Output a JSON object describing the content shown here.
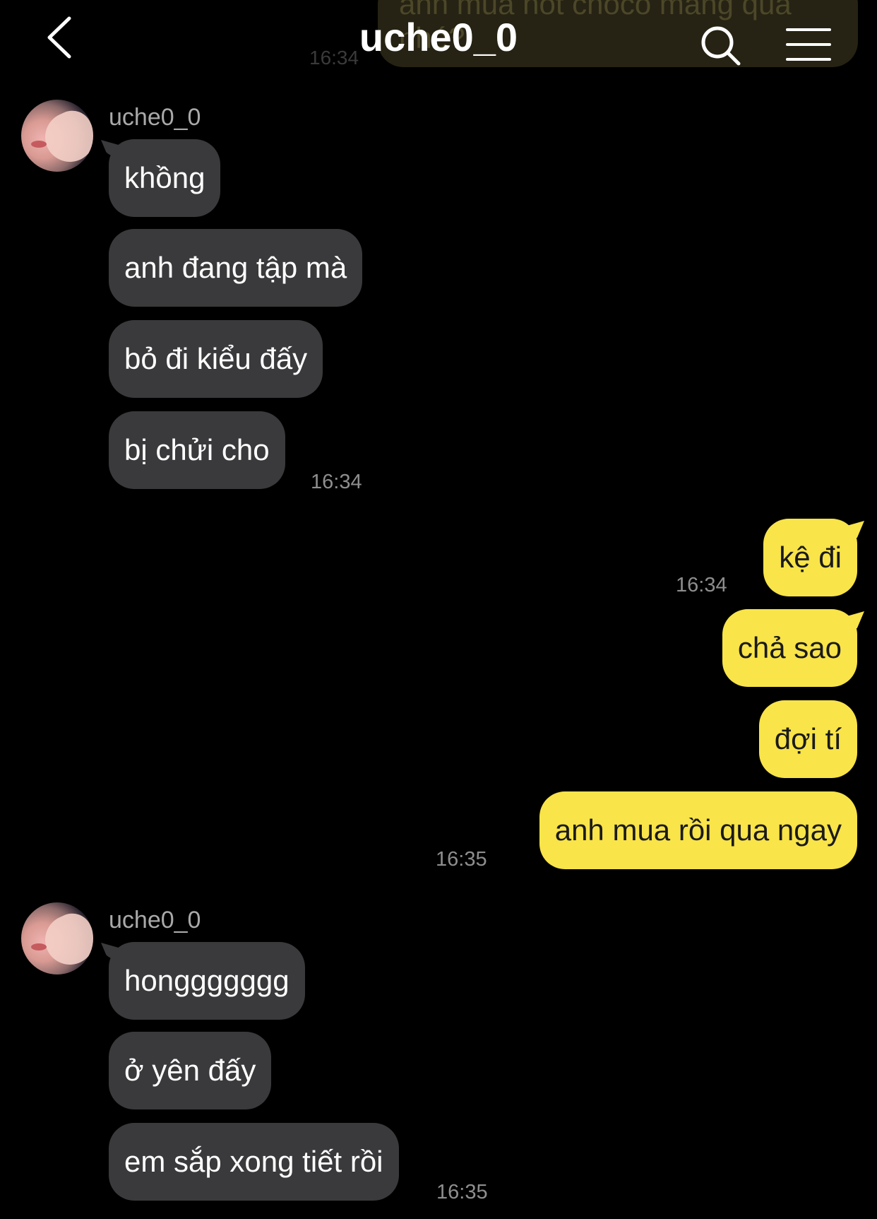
{
  "app": {
    "title": "uche0_0"
  },
  "icons": {
    "back": "chevron-left-icon",
    "search": "search-icon",
    "menu": "hamburger-menu-icon"
  },
  "colors": {
    "background": "#000000",
    "incoming_bubble": "#3a3a3c",
    "outgoing_bubble": "#f9e449",
    "timestamp": "#8e8e8e"
  },
  "previous": {
    "text": "anh mua hot choco mang qua nhé?",
    "time": "16:34"
  },
  "groups": [
    {
      "sender": "uche0_0",
      "messages": [
        "khồng",
        "anh đang tập mà",
        "bỏ đi kiểu đấy",
        "bị chửi cho"
      ],
      "time": "16:34"
    },
    {
      "sender": "uche0_0",
      "messages": [
        "honggggggg",
        "ở yên đấy",
        "em sắp xong tiết rồi"
      ],
      "time": "16:35"
    }
  ],
  "sent": [
    {
      "messages": [
        "kệ đi"
      ],
      "time": "16:34"
    },
    {
      "messages": [
        "chả sao",
        "đợi tí",
        "anh mua rồi qua ngay"
      ],
      "time": "16:35"
    }
  ]
}
